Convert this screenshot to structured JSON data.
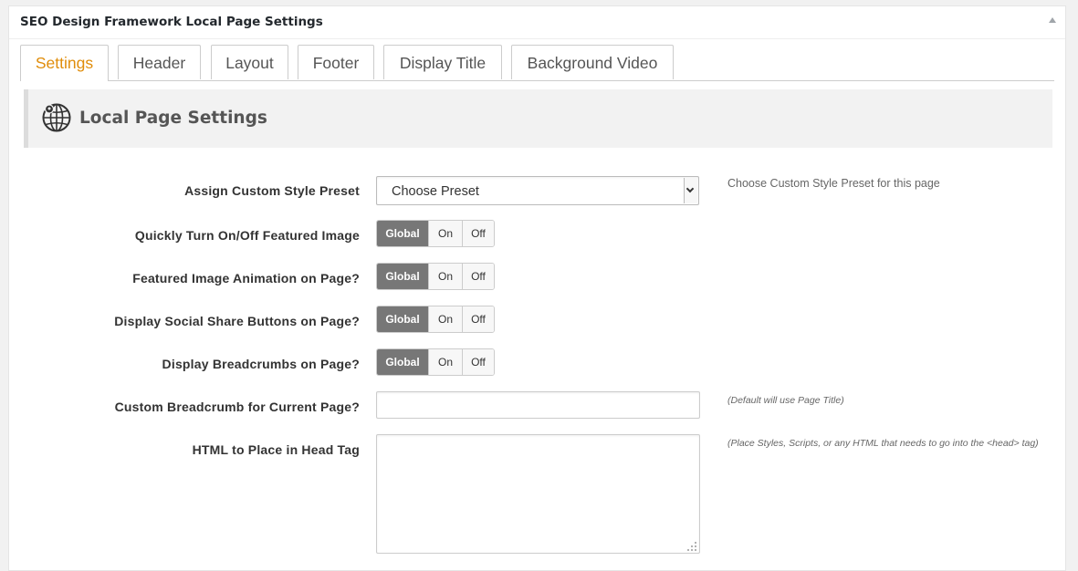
{
  "panel": {
    "title": "SEO Design Framework Local Page Settings"
  },
  "tabs": [
    {
      "label": "Settings"
    },
    {
      "label": "Header"
    },
    {
      "label": "Layout"
    },
    {
      "label": "Footer"
    },
    {
      "label": "Display Title"
    },
    {
      "label": "Background Video"
    }
  ],
  "section": {
    "title": "Local Page Settings",
    "icon": "globe-icon"
  },
  "rows": {
    "preset": {
      "label": "Assign Custom Style Preset",
      "value": "Choose Preset",
      "help": "Choose Custom Style Preset for this page"
    },
    "featured_image": {
      "label": "Quickly Turn On/Off Featured Image",
      "selected": "Global"
    },
    "featured_animation": {
      "label": "Featured Image Animation on Page?",
      "selected": "Global"
    },
    "social_share": {
      "label": "Display Social Share Buttons on Page?",
      "selected": "Global"
    },
    "breadcrumbs": {
      "label": "Display Breadcrumbs on Page?",
      "selected": "Global"
    },
    "custom_breadcrumb": {
      "label": "Custom Breadcrumb for Current Page?",
      "value": "",
      "help": "(Default will use Page Title)"
    },
    "head_html": {
      "label": "HTML to Place in Head Tag",
      "value": "",
      "help": "(Place Styles, Scripts, or any HTML that needs to go into the <head> tag)"
    }
  },
  "toggle_options": {
    "global": "Global",
    "on": "On",
    "off": "Off"
  },
  "colors": {
    "active_tab": "#e08d0b",
    "selected_segment": "#777777"
  }
}
